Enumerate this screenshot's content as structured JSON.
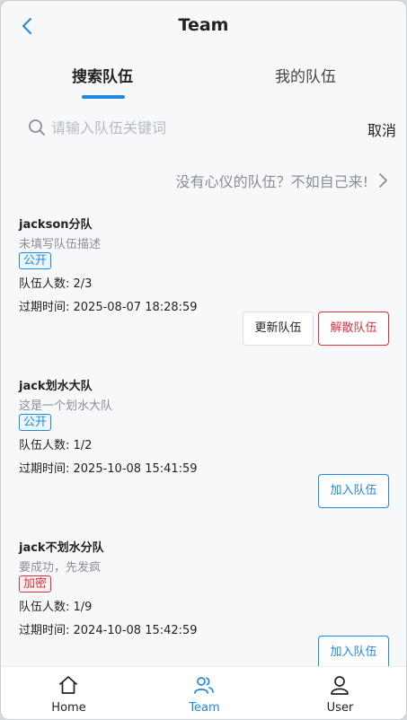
{
  "header": {
    "title": "Team"
  },
  "tabs": [
    {
      "label": "搜索队伍",
      "active": true
    },
    {
      "label": "我的队伍",
      "active": false
    }
  ],
  "search": {
    "placeholder": "请输入队伍关键词",
    "value": "",
    "cancel_label": "取消"
  },
  "create_hint": {
    "text": "没有心仪的队伍？不如自己来!"
  },
  "teams": [
    {
      "name": "jackson分队",
      "description": "未填写队伍描述",
      "status": "公开",
      "members": "队伍人数: 2/3",
      "expire": "过期时间: 2025-08-07 18:28:59",
      "actions": {
        "update": "更新队伍",
        "dissolve": "解散队伍"
      }
    },
    {
      "name": "jack划水大队",
      "description": "这是一个划水大队",
      "status": "公开",
      "members": "队伍人数: 1/2",
      "expire": "过期时间: 2025-10-08 15:41:59",
      "actions": {
        "join": "加入队伍"
      }
    },
    {
      "name": "jack不划水分队",
      "description": "要成功，先发疯",
      "status": "加密",
      "members": "队伍人数: 1/9",
      "expire": "过期时间: 2024-10-08 15:42:59",
      "actions": {
        "join": "加入队伍"
      }
    }
  ],
  "tabbar": [
    {
      "label": "Home",
      "icon": "home-icon",
      "active": false
    },
    {
      "label": "Team",
      "icon": "team-icon",
      "active": true
    },
    {
      "label": "User",
      "icon": "user-icon",
      "active": false
    }
  ],
  "colors": {
    "accent": "#1e88e5",
    "danger": "#e0313c",
    "background": "#f6f8fa"
  }
}
